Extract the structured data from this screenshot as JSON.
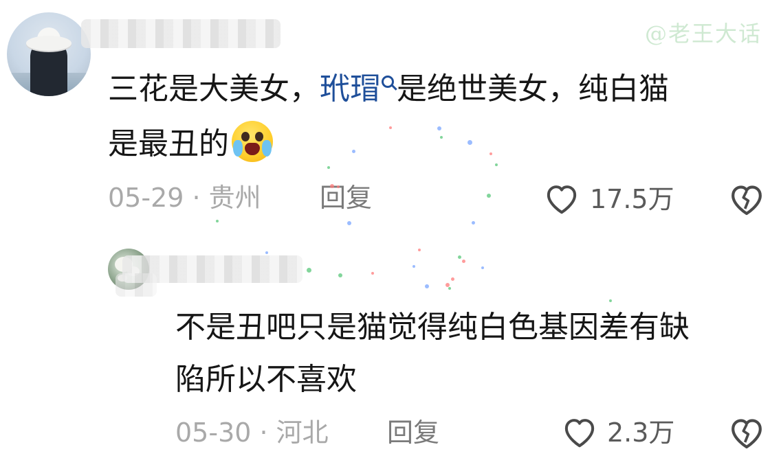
{
  "watermark": "@老王大话",
  "comments": [
    {
      "text_line1_part1": "三花是大美女，",
      "link_text": "玳瑁",
      "text_line1_part2": "是绝世美女，纯白猫",
      "text_line2": "是最丑的",
      "emoji": "crying-face-icon",
      "date": "05-29 · 贵州",
      "reply_label": "回复",
      "likes": "17.5万"
    },
    {
      "text_line1": "不是丑吧只是猫觉得纯白色基因差有缺",
      "text_line2": "陷所以不喜欢",
      "date": "05-30 · 河北",
      "reply_label": "回复",
      "likes": "2.3万"
    }
  ],
  "colors": {
    "link": "#1f4f9a",
    "meta": "#a9a9a9",
    "watermark": "#cfe9d2"
  }
}
